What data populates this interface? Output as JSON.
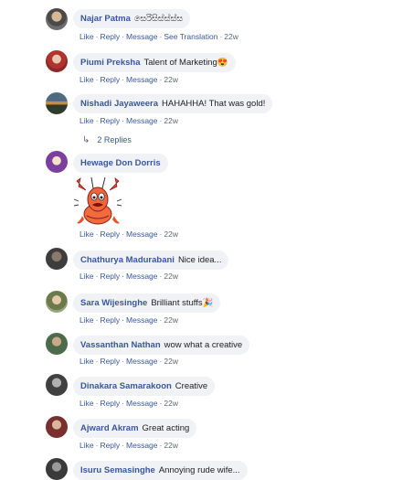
{
  "comments": [
    {
      "author": "Najar Patma",
      "text": "සෙරිසිස්ස්ස්ස",
      "emoji": "",
      "actions": [
        "Like",
        "Reply",
        "Message",
        "See Translation"
      ],
      "time": "22w"
    },
    {
      "author": "Piumi Preksha",
      "text": "Talent of Marketing",
      "emoji": "😍",
      "actions": [
        "Like",
        "Reply",
        "Message"
      ],
      "time": "22w"
    },
    {
      "author": "Nishadi Jayaweera",
      "text": "HAHAHHA! That was gold!",
      "emoji": "",
      "actions": [
        "Like",
        "Reply",
        "Message"
      ],
      "time": "22w"
    },
    {
      "author": "Hewage Don Dorris",
      "text": "",
      "emoji": "",
      "actions": [
        "Like",
        "Reply",
        "Message"
      ],
      "time": "22w"
    },
    {
      "author": "Chathurya Madurabani",
      "text": "Nice idea...",
      "emoji": "",
      "actions": [
        "Like",
        "Reply",
        "Message"
      ],
      "time": "22w"
    },
    {
      "author": "Sara Wijesinghe",
      "text": "Brilliant stuffs",
      "emoji": "🎉",
      "actions": [
        "Like",
        "Reply",
        "Message"
      ],
      "time": "22w"
    },
    {
      "author": "Vassanthan Nathan",
      "text": "wow what a creative",
      "emoji": "",
      "actions": [
        "Like",
        "Reply",
        "Message"
      ],
      "time": "22w"
    },
    {
      "author": "Dinakara Samarakoon",
      "text": "Creative",
      "emoji": "",
      "actions": [
        "Like",
        "Reply",
        "Message"
      ],
      "time": "22w"
    },
    {
      "author": "Ajward Akram",
      "text": "Great acting",
      "emoji": "",
      "actions": [
        "Like",
        "Reply",
        "Message"
      ],
      "time": "22w"
    },
    {
      "author": "Isuru Semasinghe",
      "text": "Annoying rude wife...",
      "emoji": "",
      "actions": [],
      "time": ""
    }
  ],
  "replies_link": "2 Replies",
  "replies_arrow": "↳",
  "icons": {
    "sticker": "lobster-sticker-icon",
    "reply_arrow": "reply-arrow-icon"
  },
  "colors": {
    "author": "#385898",
    "bubble": "#f0f2f5",
    "meta": "#606770"
  }
}
